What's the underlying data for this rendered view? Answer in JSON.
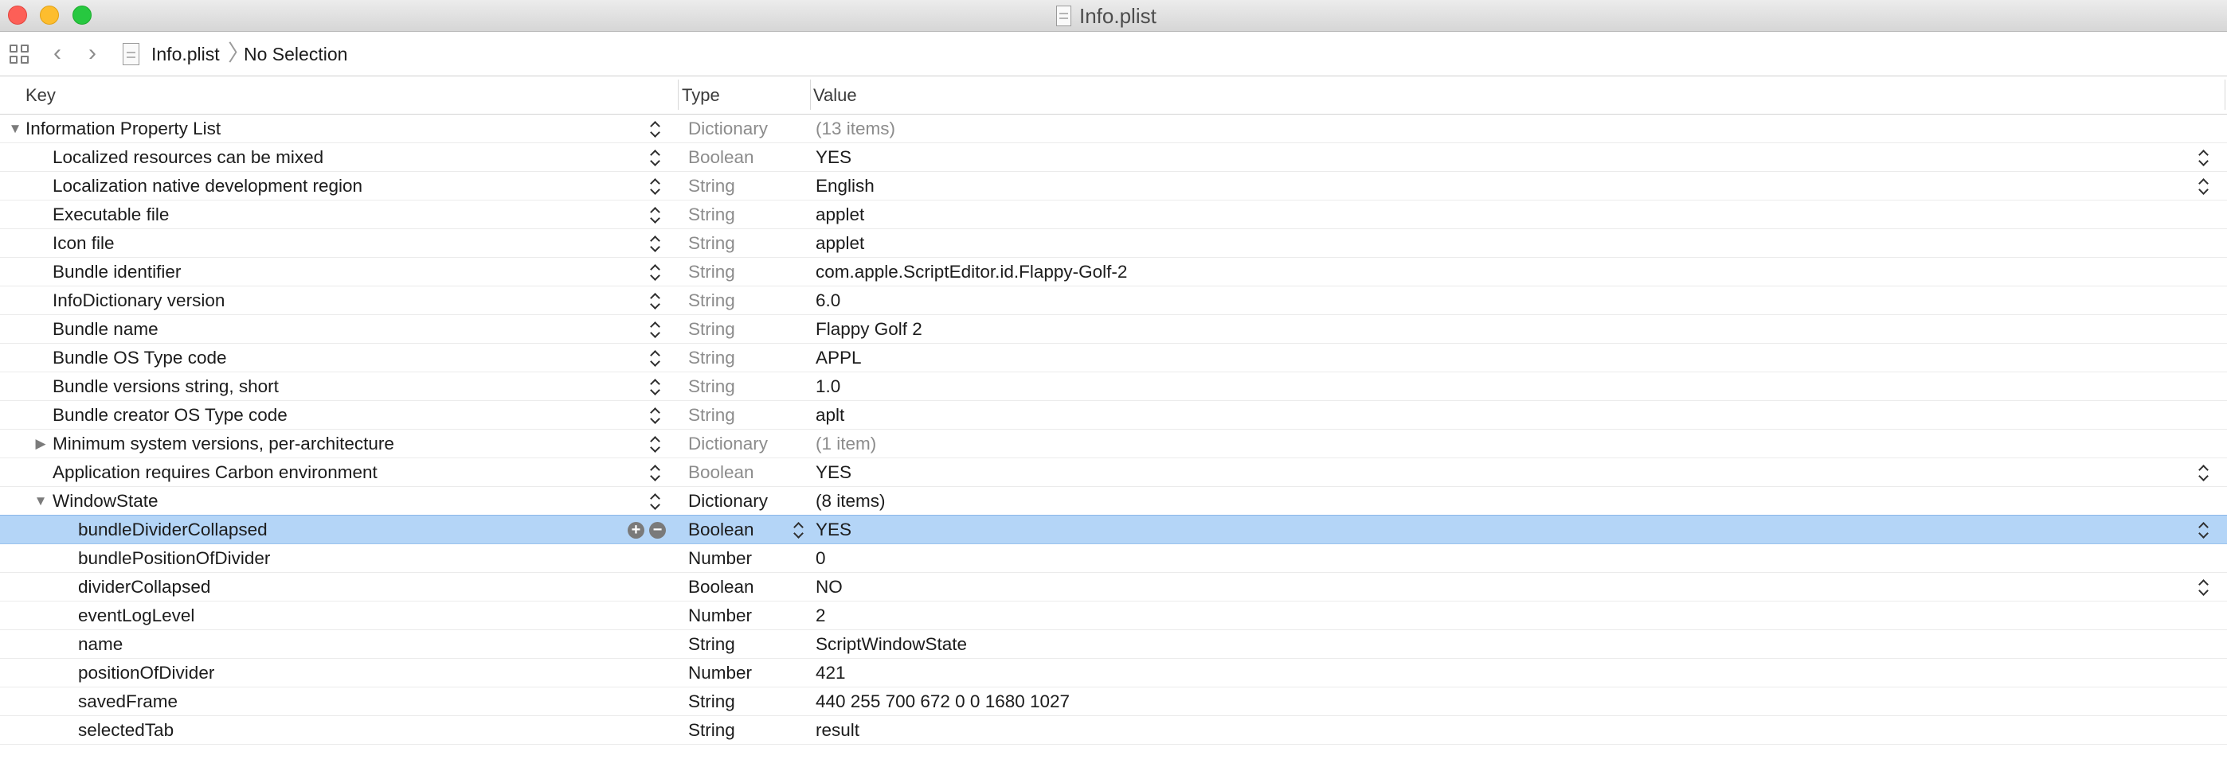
{
  "window": {
    "title": "Info.plist",
    "icon": "document-icon"
  },
  "jumpbar": {
    "grid_icon": "related-items-grid-icon",
    "back_icon": "chevron-left-icon",
    "forward_icon": "chevron-right-icon",
    "file_icon": "plist-file-icon",
    "file": "Info.plist",
    "separator": "〉",
    "selection": "No Selection"
  },
  "table": {
    "columns": {
      "key": "Key",
      "type": "Type",
      "value": "Value"
    },
    "rows": [
      {
        "key": "Information Property List",
        "type": "Dictionary",
        "value": "(13 items)",
        "level": 0,
        "disclosure": "expanded"
      },
      {
        "key": "Localized resources can be mixed",
        "type": "Boolean",
        "value": "YES",
        "level": 1,
        "value_stepper": true
      },
      {
        "key": "Localization native development region",
        "type": "String",
        "value": "English",
        "level": 1,
        "value_stepper": true
      },
      {
        "key": "Executable file",
        "type": "String",
        "value": "applet",
        "level": 1
      },
      {
        "key": "Icon file",
        "type": "String",
        "value": "applet",
        "level": 1
      },
      {
        "key": "Bundle identifier",
        "type": "String",
        "value": "com.apple.ScriptEditor.id.Flappy-Golf-2",
        "level": 1
      },
      {
        "key": "InfoDictionary version",
        "type": "String",
        "value": "6.0",
        "level": 1
      },
      {
        "key": "Bundle name",
        "type": "String",
        "value": "Flappy Golf 2",
        "level": 1
      },
      {
        "key": "Bundle OS Type code",
        "type": "String",
        "value": "APPL",
        "level": 1
      },
      {
        "key": "Bundle versions string, short",
        "type": "String",
        "value": "1.0",
        "level": 1
      },
      {
        "key": "Bundle creator OS Type code",
        "type": "String",
        "value": "aplt",
        "level": 1
      },
      {
        "key": "Minimum system versions, per-architecture",
        "type": "Dictionary",
        "value": "(1 item)",
        "level": 1,
        "disclosure": "collapsed"
      },
      {
        "key": "Application requires Carbon environment",
        "type": "Boolean",
        "value": "YES",
        "level": 1,
        "value_stepper": true
      },
      {
        "key": "WindowState",
        "type": "Dictionary",
        "value": "(8 items)",
        "level": 1,
        "disclosure": "expanded"
      },
      {
        "key": "bundleDividerCollapsed",
        "type": "Boolean",
        "value": "YES",
        "level": 2,
        "selected": true,
        "value_stepper": true
      },
      {
        "key": "bundlePositionOfDivider",
        "type": "Number",
        "value": "0",
        "level": 2
      },
      {
        "key": "dividerCollapsed",
        "type": "Boolean",
        "value": "NO",
        "level": 2,
        "value_stepper": true
      },
      {
        "key": "eventLogLevel",
        "type": "Number",
        "value": "2",
        "level": 2
      },
      {
        "key": "name",
        "type": "String",
        "value": "ScriptWindowState",
        "level": 2
      },
      {
        "key": "positionOfDivider",
        "type": "Number",
        "value": "421",
        "level": 2
      },
      {
        "key": "savedFrame",
        "type": "String",
        "value": "440 255 700 672 0 0 1680 1027",
        "level": 2
      },
      {
        "key": "selectedTab",
        "type": "String",
        "value": "result",
        "level": 2
      }
    ]
  },
  "row_buttons": {
    "add": "+",
    "remove": "−"
  },
  "colors": {
    "selection": "#b4d5f7",
    "dim_text": "#8c8c8c",
    "close": "#fd5f57",
    "minimize": "#fdbd2e",
    "zoom": "#27c840"
  }
}
